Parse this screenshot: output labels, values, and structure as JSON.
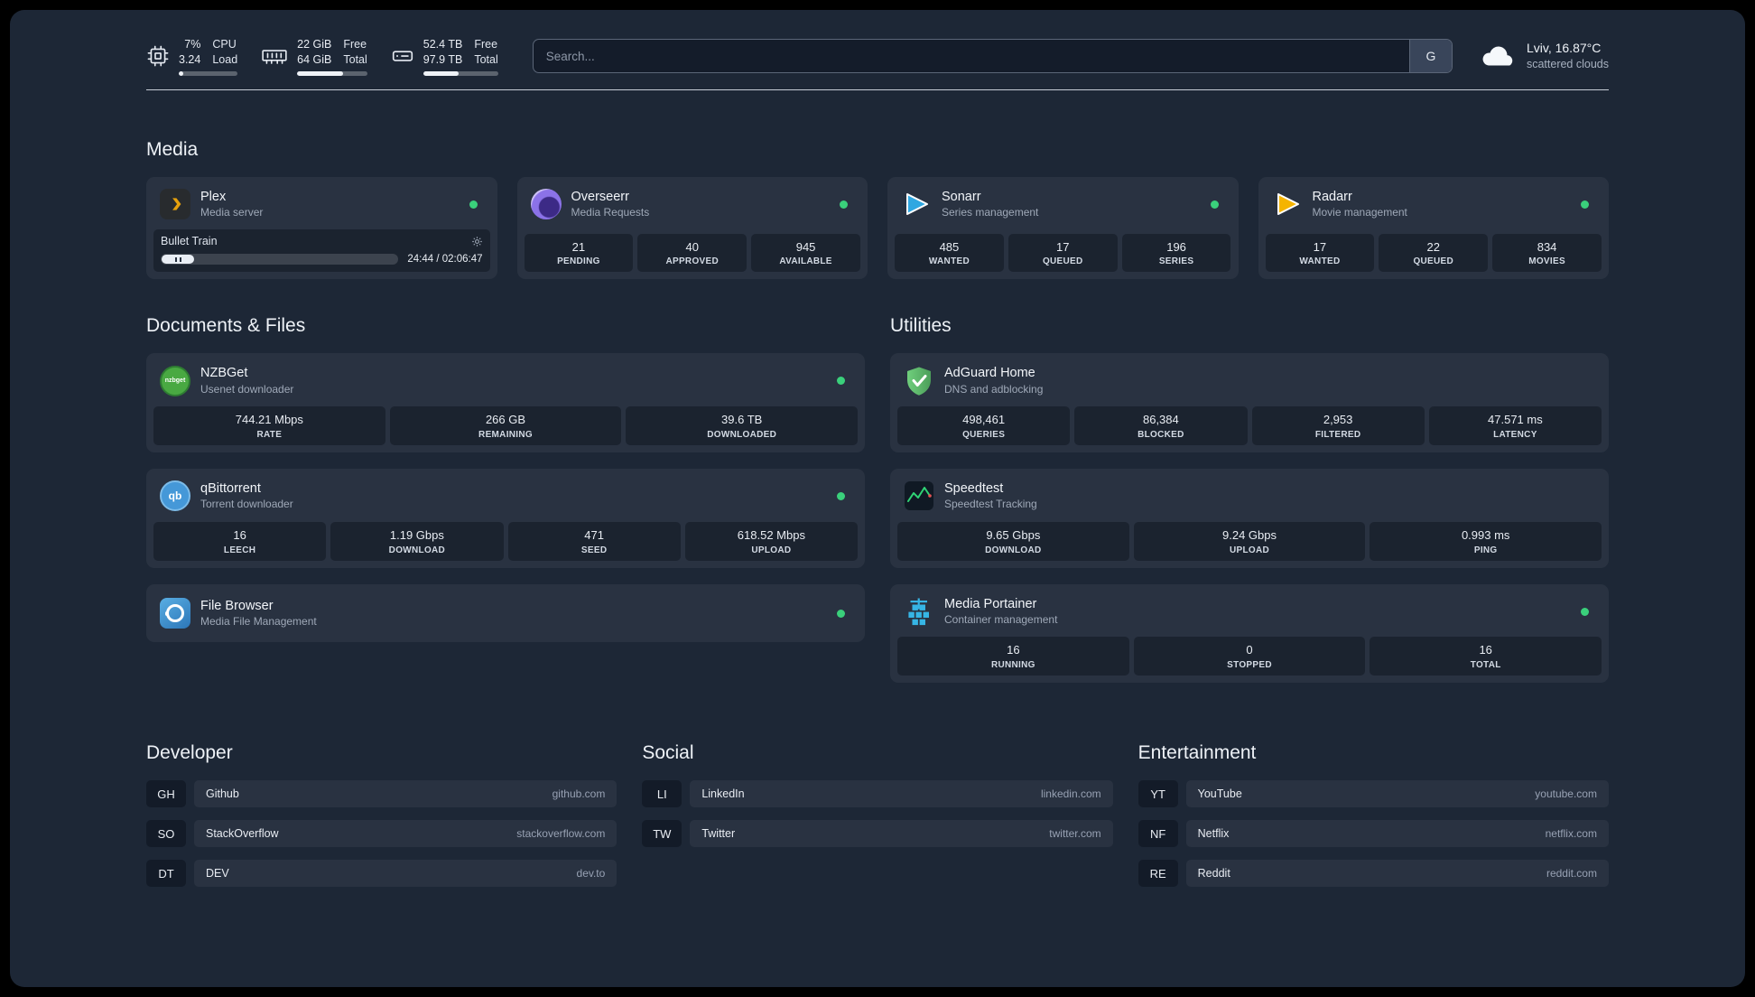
{
  "colors": {
    "background": "#1d2736",
    "status_online": "#3ad07b",
    "plex_accent": "#e5a00d",
    "sonarr_accent": "#2fa7e1",
    "radarr_accent": "#f5b400",
    "adguard_accent": "#5fb760",
    "portainer_accent": "#36b5e5",
    "speedtest_line": "#2fd475"
  },
  "topbar": {
    "resources": [
      {
        "icon": "cpu-icon",
        "values": [
          "7%",
          "3.24"
        ],
        "labels": [
          "CPU",
          "Load"
        ],
        "bar_percent": 7
      },
      {
        "icon": "memory-icon",
        "values": [
          "22 GiB",
          "64 GiB"
        ],
        "labels": [
          "Free",
          "Total"
        ],
        "bar_percent": 66
      },
      {
        "icon": "disk-icon",
        "values": [
          "52.4 TB",
          "97.9 TB"
        ],
        "labels": [
          "Free",
          "Total"
        ],
        "bar_percent": 47
      }
    ],
    "search": {
      "placeholder": "Search...",
      "provider_label": "G"
    },
    "weather": {
      "location": "Lviv, 16.87°C",
      "condition": "scattered clouds"
    }
  },
  "sections": {
    "media": {
      "title": "Media"
    },
    "documents": {
      "title": "Documents & Files"
    },
    "utilities": {
      "title": "Utilities"
    }
  },
  "services": {
    "plex": {
      "name": "Plex",
      "desc": "Media server",
      "status": "online",
      "now_playing": "Bullet Train",
      "time": "24:44 / 02:06:47"
    },
    "overseerr": {
      "name": "Overseerr",
      "desc": "Media Requests",
      "status": "online",
      "stats": [
        {
          "value": "21",
          "label": "PENDING"
        },
        {
          "value": "40",
          "label": "APPROVED"
        },
        {
          "value": "945",
          "label": "AVAILABLE"
        }
      ]
    },
    "sonarr": {
      "name": "Sonarr",
      "desc": "Series management",
      "status": "online",
      "stats": [
        {
          "value": "485",
          "label": "WANTED"
        },
        {
          "value": "17",
          "label": "QUEUED"
        },
        {
          "value": "196",
          "label": "SERIES"
        }
      ]
    },
    "radarr": {
      "name": "Radarr",
      "desc": "Movie management",
      "status": "online",
      "stats": [
        {
          "value": "17",
          "label": "WANTED"
        },
        {
          "value": "22",
          "label": "QUEUED"
        },
        {
          "value": "834",
          "label": "MOVIES"
        }
      ]
    },
    "nzbget": {
      "name": "NZBGet",
      "desc": "Usenet downloader",
      "status": "online",
      "icon_text": "nzbget",
      "stats": [
        {
          "value": "744.21 Mbps",
          "label": "RATE"
        },
        {
          "value": "266 GB",
          "label": "REMAINING"
        },
        {
          "value": "39.6 TB",
          "label": "DOWNLOADED"
        }
      ]
    },
    "qbittorrent": {
      "name": "qBittorrent",
      "desc": "Torrent downloader",
      "status": "online",
      "icon_text": "qb",
      "stats": [
        {
          "value": "16",
          "label": "LEECH"
        },
        {
          "value": "1.19 Gbps",
          "label": "DOWNLOAD"
        },
        {
          "value": "471",
          "label": "SEED"
        },
        {
          "value": "618.52 Mbps",
          "label": "UPLOAD"
        }
      ]
    },
    "filebrowser": {
      "name": "File Browser",
      "desc": "Media File Management",
      "status": "online"
    },
    "adguard": {
      "name": "AdGuard Home",
      "desc": "DNS and adblocking",
      "stats": [
        {
          "value": "498,461",
          "label": "QUERIES"
        },
        {
          "value": "86,384",
          "label": "BLOCKED"
        },
        {
          "value": "2,953",
          "label": "FILTERED"
        },
        {
          "value": "47.571 ms",
          "label": "LATENCY"
        }
      ]
    },
    "speedtest": {
      "name": "Speedtest",
      "desc": "Speedtest Tracking",
      "stats": [
        {
          "value": "9.65 Gbps",
          "label": "DOWNLOAD"
        },
        {
          "value": "9.24 Gbps",
          "label": "UPLOAD"
        },
        {
          "value": "0.993 ms",
          "label": "PING"
        }
      ]
    },
    "portainer": {
      "name": "Media Portainer",
      "desc": "Container management",
      "status": "online",
      "stats": [
        {
          "value": "16",
          "label": "RUNNING"
        },
        {
          "value": "0",
          "label": "STOPPED"
        },
        {
          "value": "16",
          "label": "TOTAL"
        }
      ]
    }
  },
  "bookmarks": {
    "developer": {
      "title": "Developer",
      "items": [
        {
          "abbr": "GH",
          "name": "Github",
          "url": "github.com"
        },
        {
          "abbr": "SO",
          "name": "StackOverflow",
          "url": "stackoverflow.com"
        },
        {
          "abbr": "DT",
          "name": "DEV",
          "url": "dev.to"
        }
      ]
    },
    "social": {
      "title": "Social",
      "items": [
        {
          "abbr": "LI",
          "name": "LinkedIn",
          "url": "linkedin.com"
        },
        {
          "abbr": "TW",
          "name": "Twitter",
          "url": "twitter.com"
        }
      ]
    },
    "entertainment": {
      "title": "Entertainment",
      "items": [
        {
          "abbr": "YT",
          "name": "YouTube",
          "url": "youtube.com"
        },
        {
          "abbr": "NF",
          "name": "Netflix",
          "url": "netflix.com"
        },
        {
          "abbr": "RE",
          "name": "Reddit",
          "url": "reddit.com"
        }
      ]
    }
  }
}
